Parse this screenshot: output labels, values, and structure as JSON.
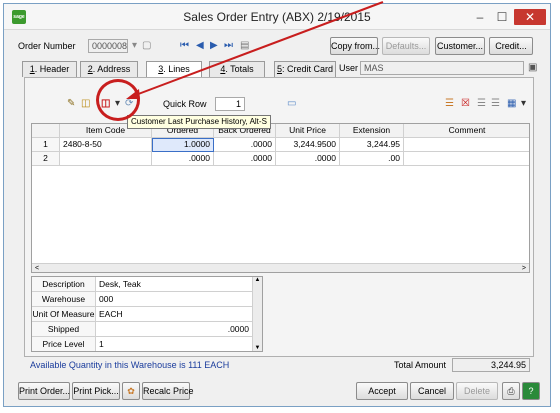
{
  "window": {
    "title": "Sales Order Entry (ABX) 2/19/2015",
    "logo": "sage",
    "minimize": "–",
    "maximize": "☐",
    "close": "✕"
  },
  "header": {
    "order_number_label": "Order Number",
    "order_number_value": "0000008",
    "copy_from": "Copy from...",
    "defaults": "Defaults...",
    "customer": "Customer...",
    "credit": "Credit..."
  },
  "tabs": [
    {
      "num": "1",
      "label": ". Header"
    },
    {
      "num": "2",
      "label": ". Address"
    },
    {
      "num": "3",
      "label": ". Lines"
    },
    {
      "num": "4",
      "label": ". Totals"
    },
    {
      "num": "5",
      "label": ": Credit Card"
    }
  ],
  "user": {
    "label": "User",
    "value": "MAS"
  },
  "toolbar": {
    "quick_row_label": "Quick Row",
    "quick_row_value": "1"
  },
  "tooltip": "Customer Last Purchase History, Alt-S",
  "grid": {
    "columns": [
      "",
      "Item Code",
      "Ordered",
      "Back Ordered",
      "Unit Price",
      "Extension",
      "Comment"
    ],
    "rows": [
      {
        "line": "1",
        "item": "2480-8-50",
        "ordered": "1.0000",
        "back": ".0000",
        "price": "3,244.9500",
        "ext": "3,244.95",
        "comment": ""
      },
      {
        "line": "2",
        "item": "",
        "ordered": ".0000",
        "back": ".0000",
        "price": ".0000",
        "ext": ".00",
        "comment": ""
      }
    ],
    "scroll_left": "<",
    "scroll_right": ">"
  },
  "details": [
    {
      "label": "Description",
      "value": "Desk, Teak"
    },
    {
      "label": "Warehouse",
      "value": "000"
    },
    {
      "label": "Unit Of Measure",
      "value": "EACH"
    },
    {
      "label": "Shipped",
      "value": ".0000"
    },
    {
      "label": "Price Level",
      "value": "1"
    }
  ],
  "footer": {
    "available": "Available Quantity in this Warehouse is 111 EACH",
    "total_label": "Total Amount",
    "total_value": "3,244.95"
  },
  "buttons": {
    "print_order": "Print Order...",
    "print_pick": "Print Pick...",
    "recalc": "Recalc Price",
    "accept": "Accept",
    "cancel": "Cancel",
    "delete": "Delete"
  },
  "colors": {
    "annotation": "#c81e1e",
    "accent": "#2a5cae",
    "status_text": "#1a3c9c"
  }
}
